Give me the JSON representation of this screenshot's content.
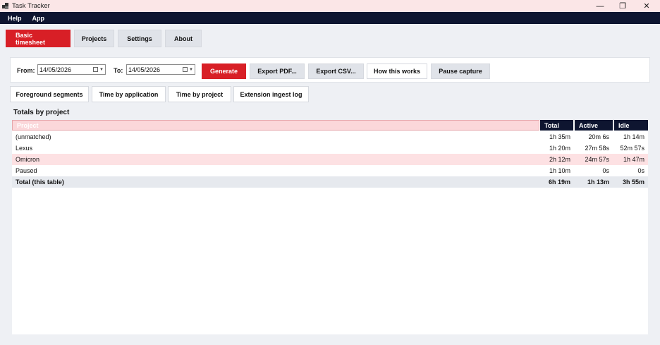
{
  "window": {
    "title": "Task Tracker",
    "controls": [
      "—",
      "❐",
      "✕"
    ]
  },
  "menu": [
    "Help",
    "App"
  ],
  "tabs": [
    {
      "label": "Basic timesheet",
      "active": true
    },
    {
      "label": "Projects",
      "active": false
    },
    {
      "label": "Settings",
      "active": false
    },
    {
      "label": "About",
      "active": false
    }
  ],
  "controls": {
    "from_label": "From:",
    "from_value": "14/05/2026",
    "to_label": "To:",
    "to_value": "14/05/2026",
    "buttons": [
      "Generate",
      "Export PDF...",
      "Export CSV...",
      "How this works",
      "Pause capture"
    ]
  },
  "subtabs": [
    "Foreground segments",
    "Time by application",
    "Time by project",
    "Extension ingest log"
  ],
  "section_title": "Totals by project",
  "table": {
    "columns": [
      "Project",
      "Total",
      "Active",
      "Idle"
    ],
    "rows": [
      {
        "project": "(unmatched)",
        "total": "1h 35m",
        "active": "20m 6s",
        "idle": "1h 14m",
        "highlight": false
      },
      {
        "project": "Lexus",
        "total": "1h 20m",
        "active": "27m 58s",
        "idle": "52m 57s",
        "highlight": false
      },
      {
        "project": "Omicron",
        "total": "2h 12m",
        "active": "24m 57s",
        "idle": "1h 47m",
        "highlight": true
      },
      {
        "project": "Paused",
        "total": "1h 10m",
        "active": "0s",
        "idle": "0s",
        "highlight": false
      }
    ],
    "footer": {
      "project": "Total (this table)",
      "total": "6h 19m",
      "active": "1h 13m",
      "idle": "3h 55m"
    }
  },
  "colors": {
    "accent": "#d81f26",
    "dark": "#0e1530",
    "highlight_row": "#fde1e3",
    "titlebar": "#fbe6e7"
  }
}
